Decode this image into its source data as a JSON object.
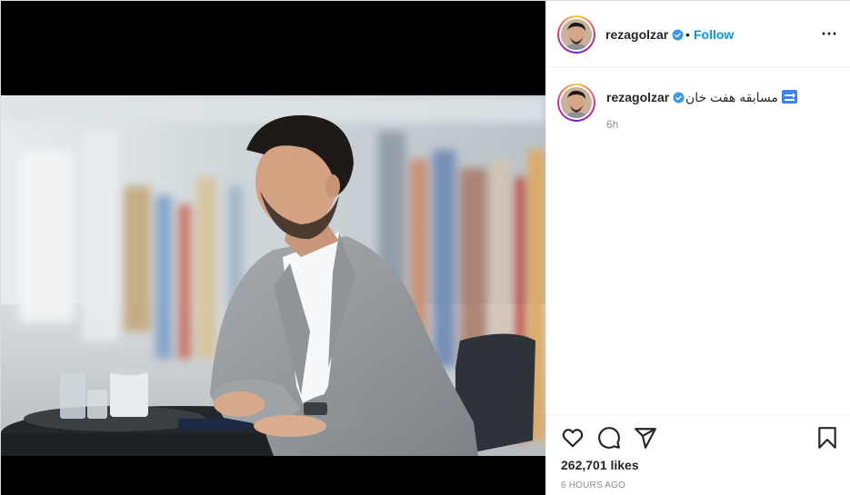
{
  "post": {
    "username": "rezagolzar",
    "verified": true,
    "follow_label": "Follow",
    "separator": "•",
    "caption_text": "مسابقه هفت خان",
    "caption_emoji_name": "soon-arrow-emoji",
    "caption_time": "6h",
    "likes": "262,701 likes",
    "time_ago": "6 HOURS AGO"
  },
  "icons": {
    "verified": "verified-badge-icon",
    "more": "more-options-icon",
    "like": "heart-icon",
    "comment": "comment-icon",
    "share": "paper-plane-icon",
    "save": "bookmark-icon"
  },
  "colors": {
    "accent": "#0095f6",
    "verified": "#3897f0",
    "text": "#262626",
    "muted": "#8e8e8e"
  }
}
